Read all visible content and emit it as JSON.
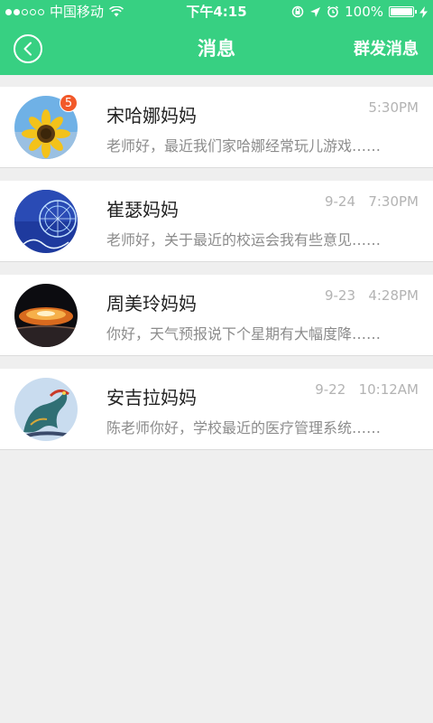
{
  "status_bar": {
    "carrier": "中国移动",
    "time": "下午4:15",
    "battery": "100%",
    "battery_level": 1.0
  },
  "navbar": {
    "title": "消息",
    "action_label": "群发消息",
    "back_icon": "chevron-left-icon"
  },
  "conversations": [
    {
      "name": "宋哈娜妈妈",
      "time": "5:30PM",
      "preview": "老师好，最近我们家哈娜经常玩儿游戏……",
      "unread": "5",
      "avatar": "sunflower"
    },
    {
      "name": "崔瑟妈妈",
      "time": "9-24   7:30PM",
      "preview": "老师好，关于最近的校运会我有些意见……",
      "unread": "",
      "avatar": "blue-ferris-wheel"
    },
    {
      "name": "周美玲妈妈",
      "time": "9-23   4:28PM",
      "preview": "你好，天气预报说下个星期有大幅度降……",
      "unread": "",
      "avatar": "dark-explosion"
    },
    {
      "name": "安吉拉妈妈",
      "time": "9-22   10:12AM",
      "preview": "陈老师你好，学校最近的医疗管理系统……",
      "unread": "",
      "avatar": "dragon-statue"
    }
  ],
  "colors": {
    "header": "#37d082",
    "badge": "#f2592a",
    "background": "#efefef"
  }
}
